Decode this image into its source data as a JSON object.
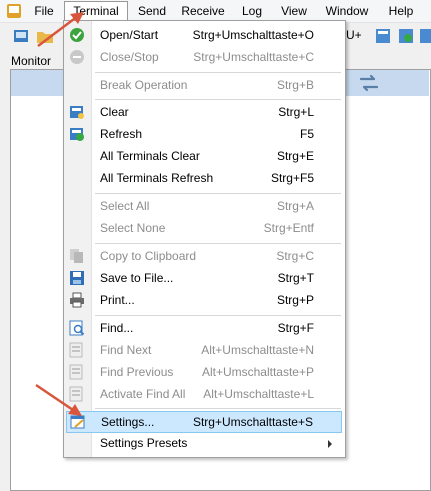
{
  "menubar": {
    "items": [
      "File",
      "Terminal",
      "Send",
      "Receive",
      "Log",
      "View",
      "Window",
      "Help"
    ]
  },
  "toolbar": {
    "partial_label": "U+"
  },
  "monitor": {
    "tab_label": "Monitor"
  },
  "dropdown": {
    "items": [
      {
        "label": "Open/Start",
        "shortcut": "Strg+Umschalttaste+O",
        "disabled": false,
        "icon": "green-check-icon"
      },
      {
        "label": "Close/Stop",
        "shortcut": "Strg+Umschalttaste+C",
        "disabled": true,
        "icon": "stop-icon"
      },
      {
        "label": "Break Operation",
        "shortcut": "Strg+B",
        "disabled": true,
        "icon": ""
      },
      {
        "label": "Clear",
        "shortcut": "Strg+L",
        "disabled": false,
        "icon": "clear-icon"
      },
      {
        "label": "Refresh",
        "shortcut": "F5",
        "disabled": false,
        "icon": "refresh-icon"
      },
      {
        "label": "All Terminals Clear",
        "shortcut": "Strg+E",
        "disabled": false,
        "icon": ""
      },
      {
        "label": "All Terminals Refresh",
        "shortcut": "Strg+F5",
        "disabled": false,
        "icon": ""
      },
      {
        "label": "Select All",
        "shortcut": "Strg+A",
        "disabled": true,
        "icon": ""
      },
      {
        "label": "Select None",
        "shortcut": "Strg+Entf",
        "disabled": true,
        "icon": ""
      },
      {
        "label": "Copy to Clipboard",
        "shortcut": "Strg+C",
        "disabled": true,
        "icon": "copy-icon"
      },
      {
        "label": "Save to File...",
        "shortcut": "Strg+T",
        "disabled": false,
        "icon": "save-icon"
      },
      {
        "label": "Print...",
        "shortcut": "Strg+P",
        "disabled": false,
        "icon": "print-icon"
      },
      {
        "label": "Find...",
        "shortcut": "Strg+F",
        "disabled": false,
        "icon": "find-icon"
      },
      {
        "label": "Find Next",
        "shortcut": "Alt+Umschalttaste+N",
        "disabled": true,
        "icon": "find-next-icon"
      },
      {
        "label": "Find Previous",
        "shortcut": "Alt+Umschalttaste+P",
        "disabled": true,
        "icon": "find-previous-icon"
      },
      {
        "label": "Activate Find All",
        "shortcut": "Alt+Umschalttaste+L",
        "disabled": true,
        "icon": "find-all-icon"
      },
      {
        "label": "Settings...",
        "shortcut": "Strg+Umschalttaste+S",
        "disabled": false,
        "icon": "settings-icon",
        "selected": true
      },
      {
        "label": "Settings Presets",
        "shortcut": "",
        "disabled": false,
        "icon": "",
        "submenu": true
      }
    ]
  },
  "colors": {
    "highlight_bg": "#cce8ff",
    "highlight_border": "#88c7f2",
    "annotation_arrow": "#d9553b",
    "monitor_strip": "#c6d9ee",
    "disabled_text": "#8d8d8d"
  }
}
